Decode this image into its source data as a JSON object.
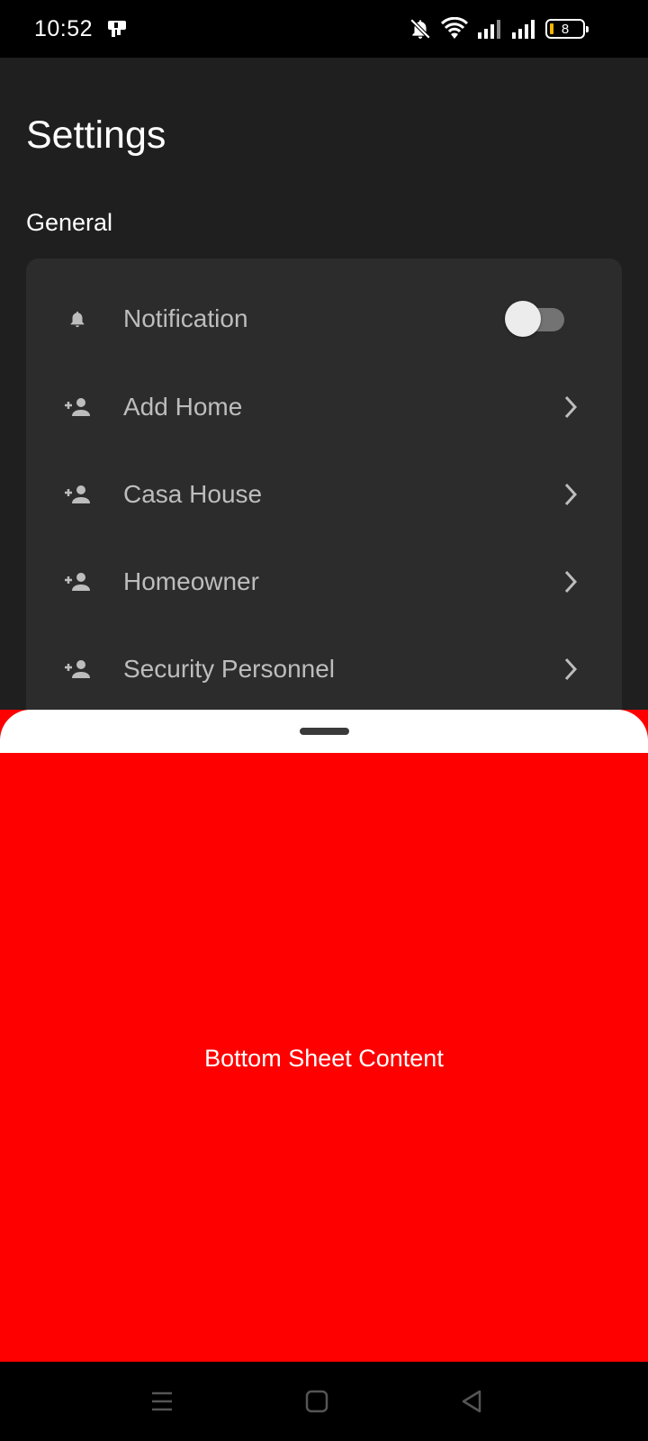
{
  "status_bar": {
    "time": "10:52",
    "battery_level": "8",
    "icons": [
      "app-notification-icon",
      "mute-icon",
      "wifi-icon",
      "signal-icon",
      "signal-icon",
      "battery-icon"
    ]
  },
  "header": {
    "title": "Settings",
    "section": "General"
  },
  "settings": {
    "items": [
      {
        "label": "Notification",
        "icon": "bell-icon",
        "control": "toggle",
        "enabled": false
      },
      {
        "label": "Add Home",
        "icon": "person-add-icon",
        "control": "chevron"
      },
      {
        "label": "Casa House",
        "icon": "person-add-icon",
        "control": "chevron"
      },
      {
        "label": "Homeowner",
        "icon": "person-add-icon",
        "control": "chevron"
      },
      {
        "label": "Security Personnel",
        "icon": "person-add-icon",
        "control": "chevron"
      }
    ]
  },
  "bottom_sheet": {
    "content": "Bottom Sheet Content",
    "background_color": "#ff0000"
  },
  "nav_bar": {
    "buttons": [
      "menu-icon",
      "home-icon",
      "back-icon"
    ]
  },
  "colors": {
    "background": "#1f1f1f",
    "card": "#2c2c2c",
    "label": "#bdbdbd",
    "accent_sheet": "#ff0000"
  }
}
